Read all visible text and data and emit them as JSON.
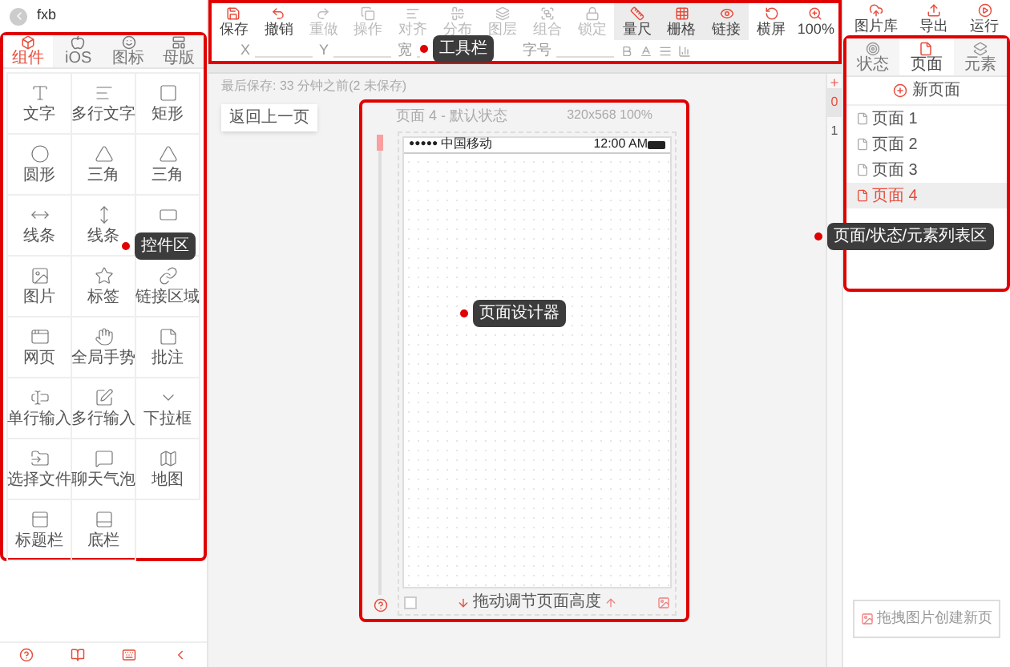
{
  "app": {
    "title": "fxb"
  },
  "toolbar": {
    "items": [
      {
        "label": "保存",
        "disabled": false,
        "on": false
      },
      {
        "label": "撤销",
        "disabled": false,
        "on": false
      },
      {
        "label": "重做",
        "disabled": true,
        "on": false
      },
      {
        "label": "操作",
        "disabled": true,
        "on": false
      },
      {
        "label": "对齐",
        "disabled": true,
        "on": false
      },
      {
        "label": "分布",
        "disabled": true,
        "on": false
      },
      {
        "label": "图层",
        "disabled": true,
        "on": false
      },
      {
        "label": "组合",
        "disabled": true,
        "on": false
      },
      {
        "label": "锁定",
        "disabled": true,
        "on": false
      },
      {
        "label": "量尺",
        "disabled": false,
        "on": true
      },
      {
        "label": "栅格",
        "disabled": false,
        "on": true
      },
      {
        "label": "链接",
        "disabled": false,
        "on": true
      },
      {
        "label": "横屏",
        "disabled": false,
        "on": false
      },
      {
        "label": "100%",
        "disabled": false,
        "on": false
      }
    ],
    "properties": [
      "X",
      "Y",
      "宽",
      "字号"
    ]
  },
  "actions": [
    "图片库",
    "导出",
    "运行"
  ],
  "left_tabs": [
    {
      "label": "组件",
      "selected": true
    },
    {
      "label": "iOS",
      "selected": false
    },
    {
      "label": "图标",
      "selected": false
    },
    {
      "label": "母版",
      "selected": false
    }
  ],
  "components": [
    {
      "kind": "labeled",
      "label": "文字"
    },
    {
      "kind": "labeled",
      "label": "多行文字"
    },
    {
      "kind": "labeled",
      "label": "矩形"
    },
    {
      "kind": "labeled",
      "label": "圆形"
    },
    {
      "kind": "labeled",
      "label": "三角"
    },
    {
      "kind": "labeled",
      "label": "三角"
    },
    {
      "kind": "labeled",
      "label": "线条"
    },
    {
      "kind": "labeled",
      "label": "线条"
    },
    {
      "kind": "icon_only"
    },
    {
      "kind": "labeled",
      "label": "图片"
    },
    {
      "kind": "labeled",
      "label": "标签"
    },
    {
      "kind": "labeled",
      "label": "链接区域"
    },
    {
      "kind": "labeled",
      "label": "网页"
    },
    {
      "kind": "labeled",
      "label": "全局手势"
    },
    {
      "kind": "labeled",
      "label": "批注"
    },
    {
      "kind": "labeled",
      "label": "单行输入"
    },
    {
      "kind": "labeled",
      "label": "多行输入"
    },
    {
      "kind": "labeled",
      "label": "下拉框"
    },
    {
      "kind": "labeled",
      "label": "选择文件"
    },
    {
      "kind": "labeled",
      "label": "聊天气泡"
    },
    {
      "kind": "labeled",
      "label": "地图"
    },
    {
      "kind": "labeled",
      "label": "标题栏"
    },
    {
      "kind": "labeled",
      "label": "底栏"
    }
  ],
  "canvas": {
    "save_status": "最后保存: 33 分钟之前(2 未保存)",
    "back_button": "返回上一页",
    "page_title": "页面 4 - 默认状态",
    "page_size": "320x568 100%",
    "signal": "●●●●●",
    "carrier": "中国移动",
    "page_height": {
      "level": 0
    },
    "checkbox": {
      "checked": false
    },
    "time": "12:00 AM",
    "resize_hint": "拖动调节页面高度",
    "state_strip": [
      "0",
      "1"
    ]
  },
  "right_tabs": [
    {
      "label": "状态",
      "selected": false
    },
    {
      "label": "页面",
      "selected": true
    },
    {
      "label": "元素",
      "selected": false
    }
  ],
  "new_page": "新页面",
  "pages": [
    {
      "label": "页面 1",
      "selected": false
    },
    {
      "label": "页面 2",
      "selected": false
    },
    {
      "label": "页面 3",
      "selected": false
    },
    {
      "label": "页面 4",
      "selected": true
    }
  ],
  "drop_hint": "拖拽图片创建新页",
  "annotations": [
    "工具栏",
    "控件区",
    "页面设计器",
    "页面/状态/元素列表区"
  ]
}
